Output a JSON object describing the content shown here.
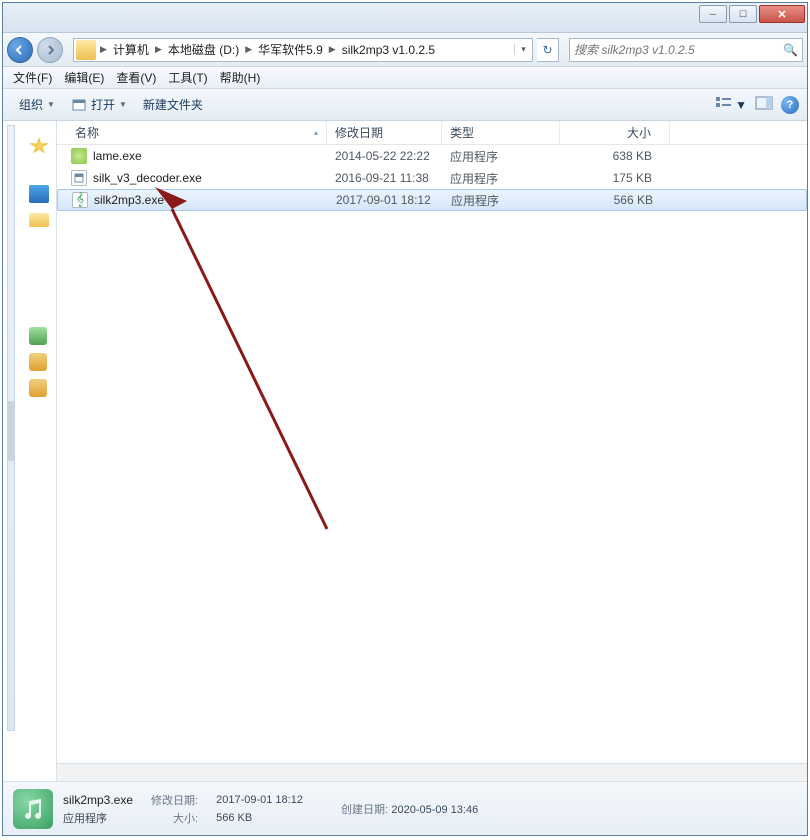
{
  "window_controls": {
    "min": "─",
    "max": "☐",
    "close": "✕"
  },
  "breadcrumb": {
    "segments": [
      "计算机",
      "本地磁盘 (D:)",
      "华军软件5.9",
      "silk2mp3 v1.0.2.5"
    ]
  },
  "search": {
    "placeholder": "搜索 silk2mp3 v1.0.2.5"
  },
  "menubar": [
    "文件(F)",
    "编辑(E)",
    "查看(V)",
    "工具(T)",
    "帮助(H)"
  ],
  "toolbar": {
    "organize": "组织",
    "open": "打开",
    "newfolder": "新建文件夹"
  },
  "columns": {
    "name": "名称",
    "date": "修改日期",
    "type": "类型",
    "size": "大小"
  },
  "files": [
    {
      "icon": "lame",
      "name": "lame.exe",
      "date": "2014-05-22 22:22",
      "type": "应用程序",
      "size": "638 KB",
      "selected": false
    },
    {
      "icon": "exe",
      "name": "silk_v3_decoder.exe",
      "date": "2016-09-21 11:38",
      "type": "应用程序",
      "size": "175 KB",
      "selected": false
    },
    {
      "icon": "music",
      "name": "silk2mp3.exe",
      "date": "2017-09-01 18:12",
      "type": "应用程序",
      "size": "566 KB",
      "selected": true
    }
  ],
  "details": {
    "name": "silk2mp3.exe",
    "type": "应用程序",
    "mod_label": "修改日期:",
    "mod_value": "2017-09-01 18:12",
    "created_label": "创建日期:",
    "created_value": "2020-05-09 13:46",
    "size_label": "大小:",
    "size_value": "566 KB"
  }
}
